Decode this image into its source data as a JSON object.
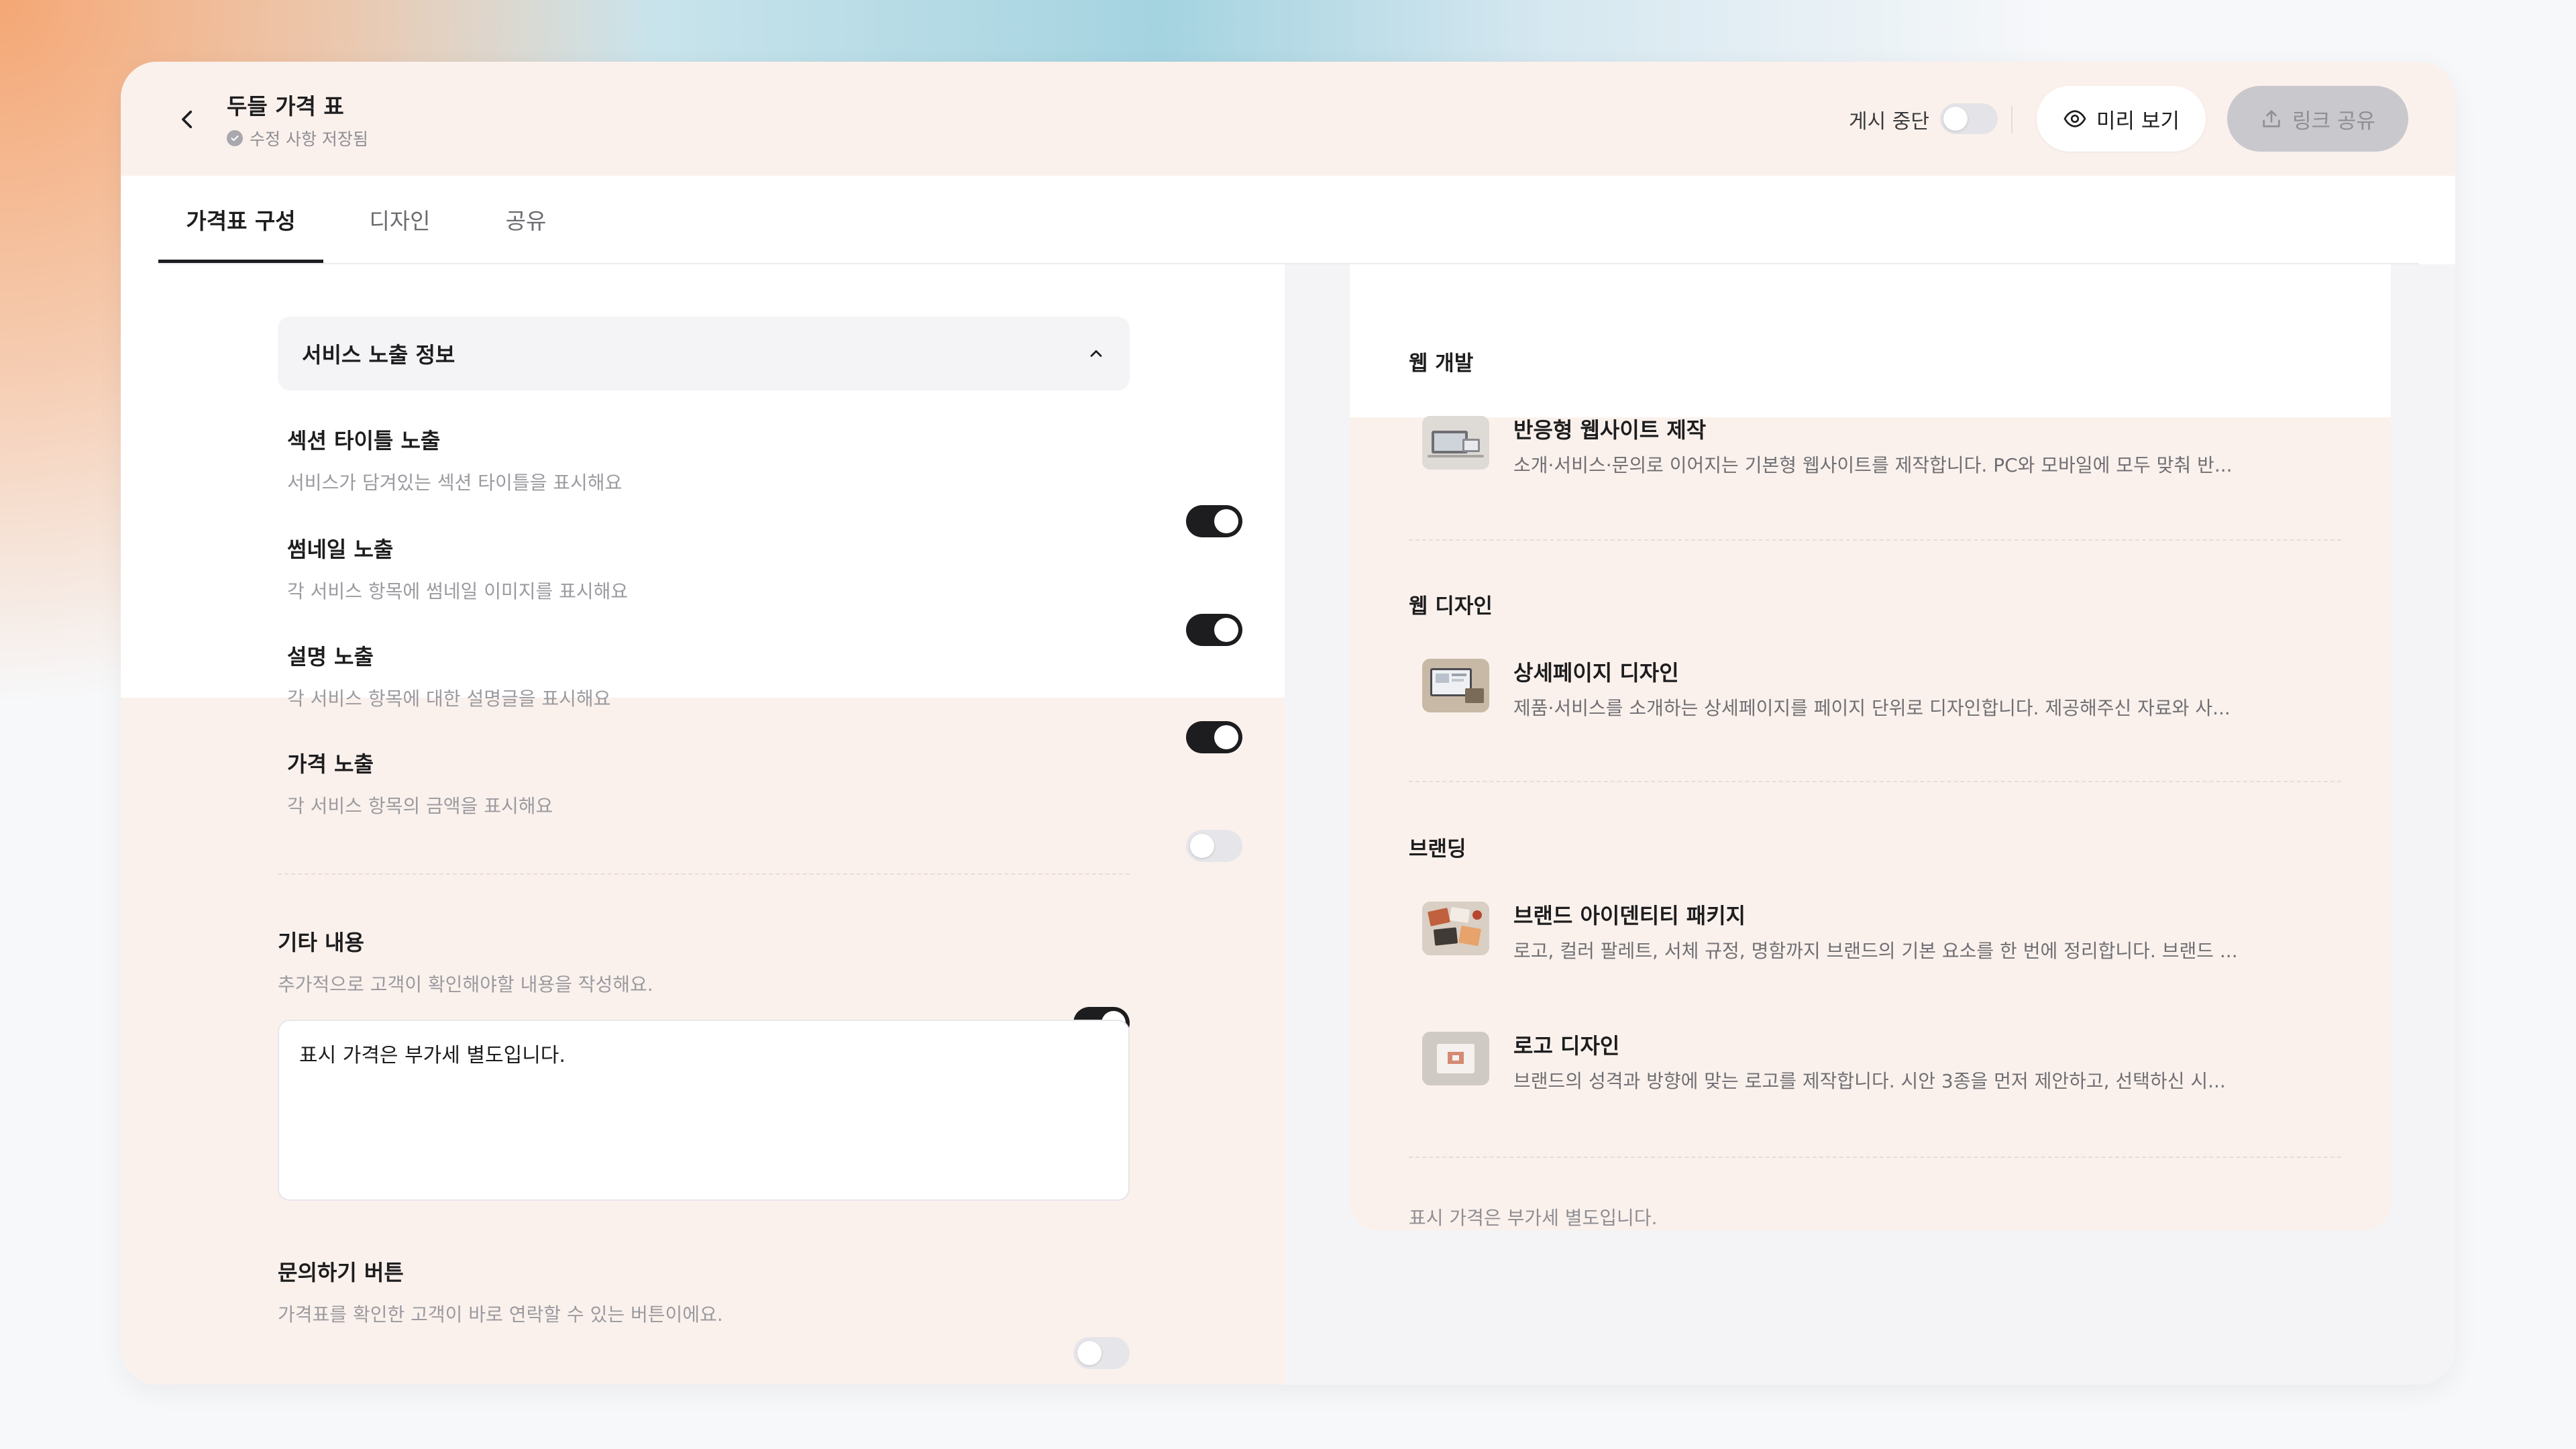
{
  "header": {
    "title": "두들 가격 표",
    "save_status": "수정 사항 저장됨",
    "publish_label": "게시 중단",
    "publish_on": false,
    "preview_label": "미리 보기",
    "share_label": "링크 공유"
  },
  "tabs": [
    {
      "label": "가격표 구성",
      "active": true
    },
    {
      "label": "디자인",
      "active": false
    },
    {
      "label": "공유",
      "active": false
    }
  ],
  "settings": {
    "section_title": "서비스 노출 정보",
    "options": [
      {
        "title": "섹션 타이틀 노출",
        "desc": "서비스가 담겨있는 섹션 타이틀을 표시해요",
        "on": true
      },
      {
        "title": "썸네일 노출",
        "desc": "각 서비스 항목에 썸네일 이미지를 표시해요",
        "on": true
      },
      {
        "title": "설명 노출",
        "desc": "각 서비스 항목에 대한 설명글을 표시해요",
        "on": true
      },
      {
        "title": "가격 노출",
        "desc": "각 서비스 항목의 금액을 표시해요",
        "on": false
      }
    ],
    "extra": {
      "title": "기타 내용",
      "desc": "추가적으로 고객이 확인해야할 내용을 작성해요.",
      "on": true,
      "value": "표시 가격은 부가세 별도입니다."
    },
    "contact": {
      "title": "문의하기 버튼",
      "desc": "가격표를 확인한 고객이 바로 연락할 수 있는 버튼이에요.",
      "on": false
    }
  },
  "preview": {
    "categories": [
      {
        "name": "웹 개발",
        "items": [
          {
            "name": "반응형 웹사이트 제작",
            "desc": "소개·서비스·문의로 이어지는 기본형 웹사이트를 제작합니다. PC와 모바일에 모두 맞춰 반..."
          }
        ]
      },
      {
        "name": "웹 디자인",
        "items": [
          {
            "name": "상세페이지 디자인",
            "desc": "제품·서비스를 소개하는 상세페이지를 페이지 단위로 디자인합니다. 제공해주신 자료와 사..."
          }
        ]
      },
      {
        "name": "브랜딩",
        "items": [
          {
            "name": "브랜드 아이덴티티 패키지",
            "desc": "로고, 컬러 팔레트, 서체 규정, 명함까지 브랜드의 기본 요소를 한 번에 정리합니다. 브랜드 ..."
          },
          {
            "name": "로고 디자인",
            "desc": "브랜드의 성격과 방향에 맞는 로고를 제작합니다. 시안 3종을 먼저 제안하고, 선택하신 시..."
          }
        ]
      }
    ],
    "note": "표시 가격은 부가세 별도입니다."
  },
  "icons": {
    "back": "chevron-left-icon",
    "saved": "check-circle-icon",
    "preview": "eye-icon",
    "share": "upload-icon",
    "collapse": "chevron-up-icon"
  }
}
